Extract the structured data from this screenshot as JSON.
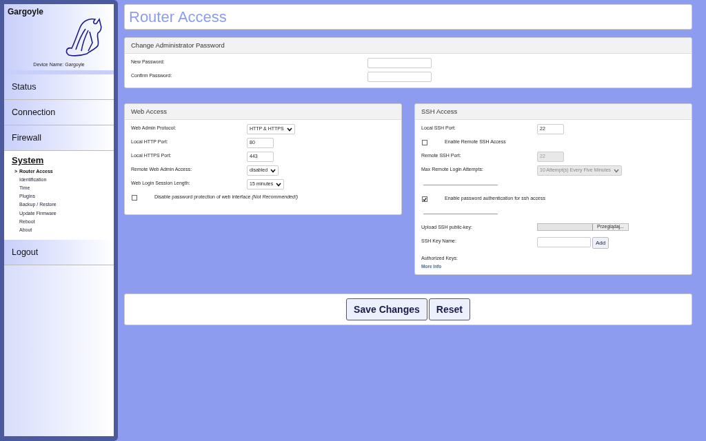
{
  "sidebar": {
    "brand": "Gargoyle",
    "device_name": "Device Name: Gargoyle",
    "nav": [
      {
        "label": "Status",
        "selected": false
      },
      {
        "label": "Connection",
        "selected": false
      },
      {
        "label": "Firewall",
        "selected": false
      },
      {
        "label": "System",
        "selected": true,
        "children": [
          {
            "label": "Router Access",
            "selected": true,
            "marker": ">"
          },
          {
            "label": "Identification",
            "selected": false
          },
          {
            "label": "Time",
            "selected": false
          },
          {
            "label": "Plugins",
            "selected": false
          },
          {
            "label": "Backup / Restore",
            "selected": false
          },
          {
            "label": "Update Firmware",
            "selected": false
          },
          {
            "label": "Reboot",
            "selected": false
          },
          {
            "label": "About",
            "selected": false
          }
        ]
      },
      {
        "label": "Logout",
        "selected": false
      }
    ]
  },
  "page_title": "Router Access",
  "password_panel": {
    "title": "Change Administrator Password",
    "rows": [
      {
        "kind": "input",
        "label": "New Password:",
        "value": "",
        "disabled": false
      },
      {
        "kind": "input",
        "label": "Confirm Password:",
        "value": "",
        "disabled": false
      }
    ]
  },
  "web_access": {
    "title": "Web Access",
    "rows": [
      {
        "kind": "select",
        "label": "Web Admin Protocol:",
        "value": "HTTP & HTTPS",
        "disabled": false
      },
      {
        "kind": "input",
        "label": "Local HTTP Port:",
        "value": "80",
        "disabled": false
      },
      {
        "kind": "input",
        "label": "Local HTTPS Port:",
        "value": "443",
        "disabled": false
      },
      {
        "kind": "select",
        "label": "Remote Web Admin Access:",
        "value": "disabled",
        "disabled": false
      },
      {
        "kind": "select",
        "label": "Web Login Session Length:",
        "value": "15 minutes",
        "disabled": false
      },
      {
        "kind": "checkbox",
        "label": "Disable password protection of web interface *(Not Recommended!)*",
        "checked": false
      }
    ]
  },
  "ssh_access": {
    "title": "SSH Access",
    "rows": [
      {
        "kind": "input",
        "label": "Local SSH Port:",
        "value": "22",
        "disabled": false
      },
      {
        "kind": "checkbox",
        "label": "Enable Remote SSH Access",
        "checked": false
      },
      {
        "kind": "input",
        "label": "Remote SSH Port:",
        "value": "22",
        "disabled": true
      },
      {
        "kind": "select",
        "label": "Max Remote Login Attempts:",
        "value": "10 Attempt(s) Every Five Minutes",
        "disabled": true
      },
      {
        "kind": "rule"
      },
      {
        "kind": "checkbox",
        "label": "Enable password authentication for ssh access",
        "checked": true
      },
      {
        "kind": "rule"
      },
      {
        "kind": "file",
        "label": "Upload SSH public-key:",
        "button": "Przeglądaj..."
      },
      {
        "kind": "input_button",
        "label": "SSH Key Name:",
        "value": "",
        "disabled": false,
        "button": "Add"
      },
      {
        "kind": "text",
        "label": "Authorized Keys:"
      },
      {
        "kind": "link",
        "label": "More Info"
      }
    ]
  },
  "buttons": [
    "Save Changes",
    "Reset"
  ]
}
